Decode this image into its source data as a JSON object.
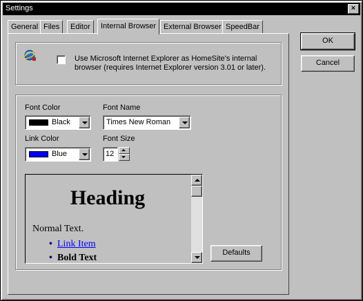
{
  "window": {
    "title": "Settings",
    "close_glyph": "×"
  },
  "tabs": [
    {
      "label": "General",
      "active": false
    },
    {
      "label": "Files",
      "active": false
    },
    {
      "label": "Editor",
      "active": false
    },
    {
      "label": "Internal Browser",
      "active": true
    },
    {
      "label": "External Browser",
      "active": false
    },
    {
      "label": "SpeedBar",
      "active": false
    }
  ],
  "ie_option": {
    "icon": "internet-explorer-icon",
    "checked": false,
    "label": "Use Microsoft Internet Explorer as HomeSite's internal browser (requires Internet Explorer version 3.01 or later)."
  },
  "font_color": {
    "label": "Font Color",
    "value": "Black",
    "swatch": "#000000"
  },
  "font_name": {
    "label": "Font Name",
    "value": "Times New Roman"
  },
  "link_color": {
    "label": "Link Color",
    "value": "Blue",
    "swatch": "#0000ff"
  },
  "font_size": {
    "label": "Font Size",
    "value": "12"
  },
  "preview": {
    "heading": "Heading",
    "normal": "Normal Text.",
    "link_item": "Link Item",
    "bold_text": "Bold Text"
  },
  "buttons": {
    "ok": "OK",
    "cancel": "Cancel",
    "defaults": "Defaults"
  }
}
